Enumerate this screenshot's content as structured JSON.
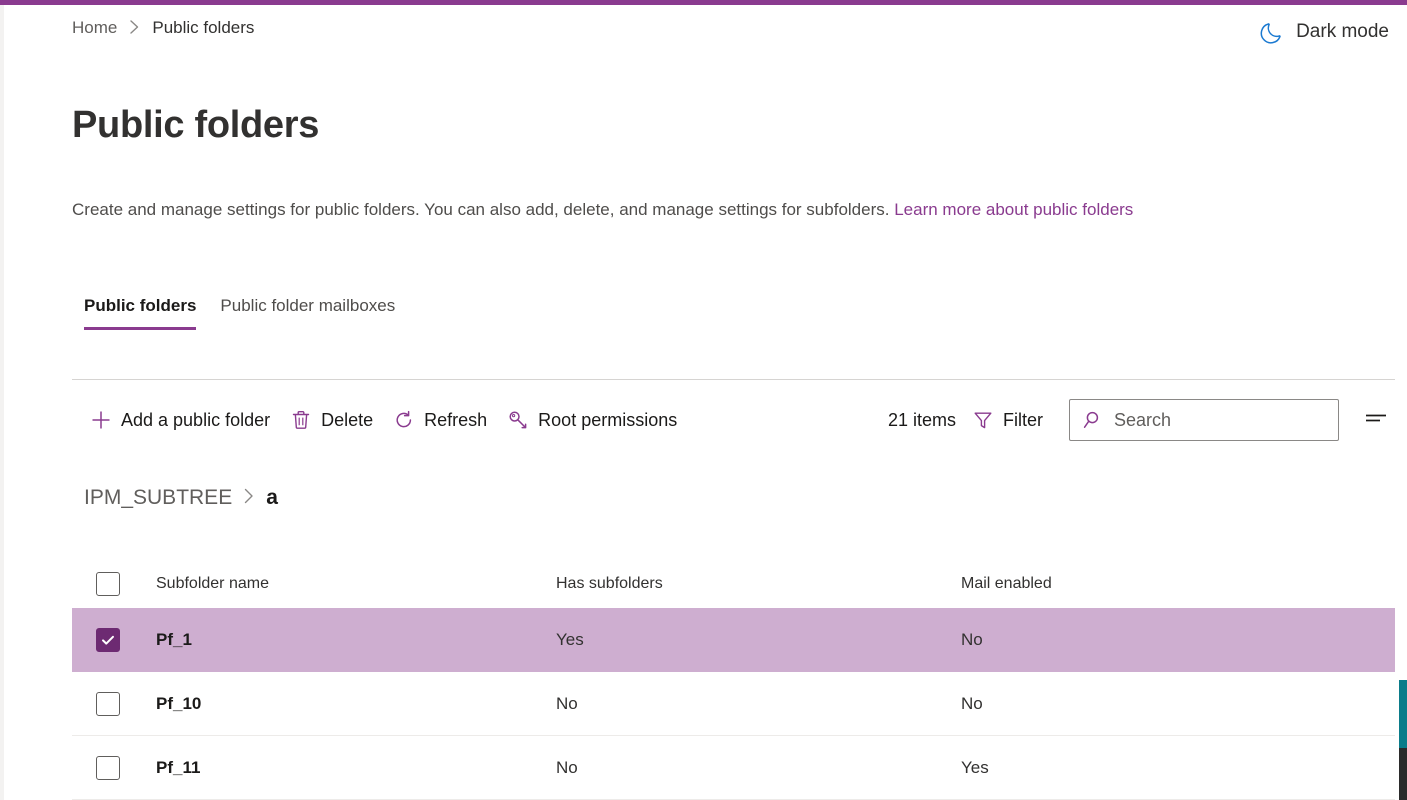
{
  "theme": {
    "accent": "#8a3b8f",
    "accent_dark": "#6d2a72",
    "selected_row_bg": "#ceaed0",
    "moon_icon_color": "#1b7ad1",
    "scrollbar_teal": "#0b7c8a"
  },
  "breadcrumb": {
    "home": "Home",
    "separator": "›",
    "current": "Public folders"
  },
  "dark_mode": {
    "label": "Dark mode",
    "icon": "moon-icon"
  },
  "header": {
    "title": "Public folders",
    "description": "Create and manage settings for public folders. You can also add, delete, and manage settings for subfolders.",
    "link_text": "Learn more about public folders"
  },
  "tabs": [
    {
      "label": "Public folders",
      "active": true
    },
    {
      "label": "Public folder mailboxes",
      "active": false
    }
  ],
  "toolbar": {
    "commands": [
      {
        "label": "Add a public folder",
        "icon": "plus-icon"
      },
      {
        "label": "Delete",
        "icon": "trash-icon"
      },
      {
        "label": "Refresh",
        "icon": "refresh-icon"
      },
      {
        "label": "Root permissions",
        "icon": "key-icon"
      }
    ],
    "items_count": "21 items",
    "filter_label": "Filter",
    "filter_icon": "funnel-icon",
    "search_placeholder": "Search",
    "search_value": "",
    "search_icon": "search-icon",
    "list_view_icon": "list-options-icon"
  },
  "folder_path": {
    "root": "IPM_SUBTREE",
    "separator": "›",
    "current": "a"
  },
  "table": {
    "columns": [
      "Subfolder name",
      "Has subfolders",
      "Mail enabled"
    ],
    "rows": [
      {
        "name": "Pf_1",
        "has_subfolders": "Yes",
        "mail_enabled": "No",
        "selected": true
      },
      {
        "name": "Pf_10",
        "has_subfolders": "No",
        "mail_enabled": "No",
        "selected": false
      },
      {
        "name": "Pf_11",
        "has_subfolders": "No",
        "mail_enabled": "Yes",
        "selected": false
      }
    ]
  }
}
